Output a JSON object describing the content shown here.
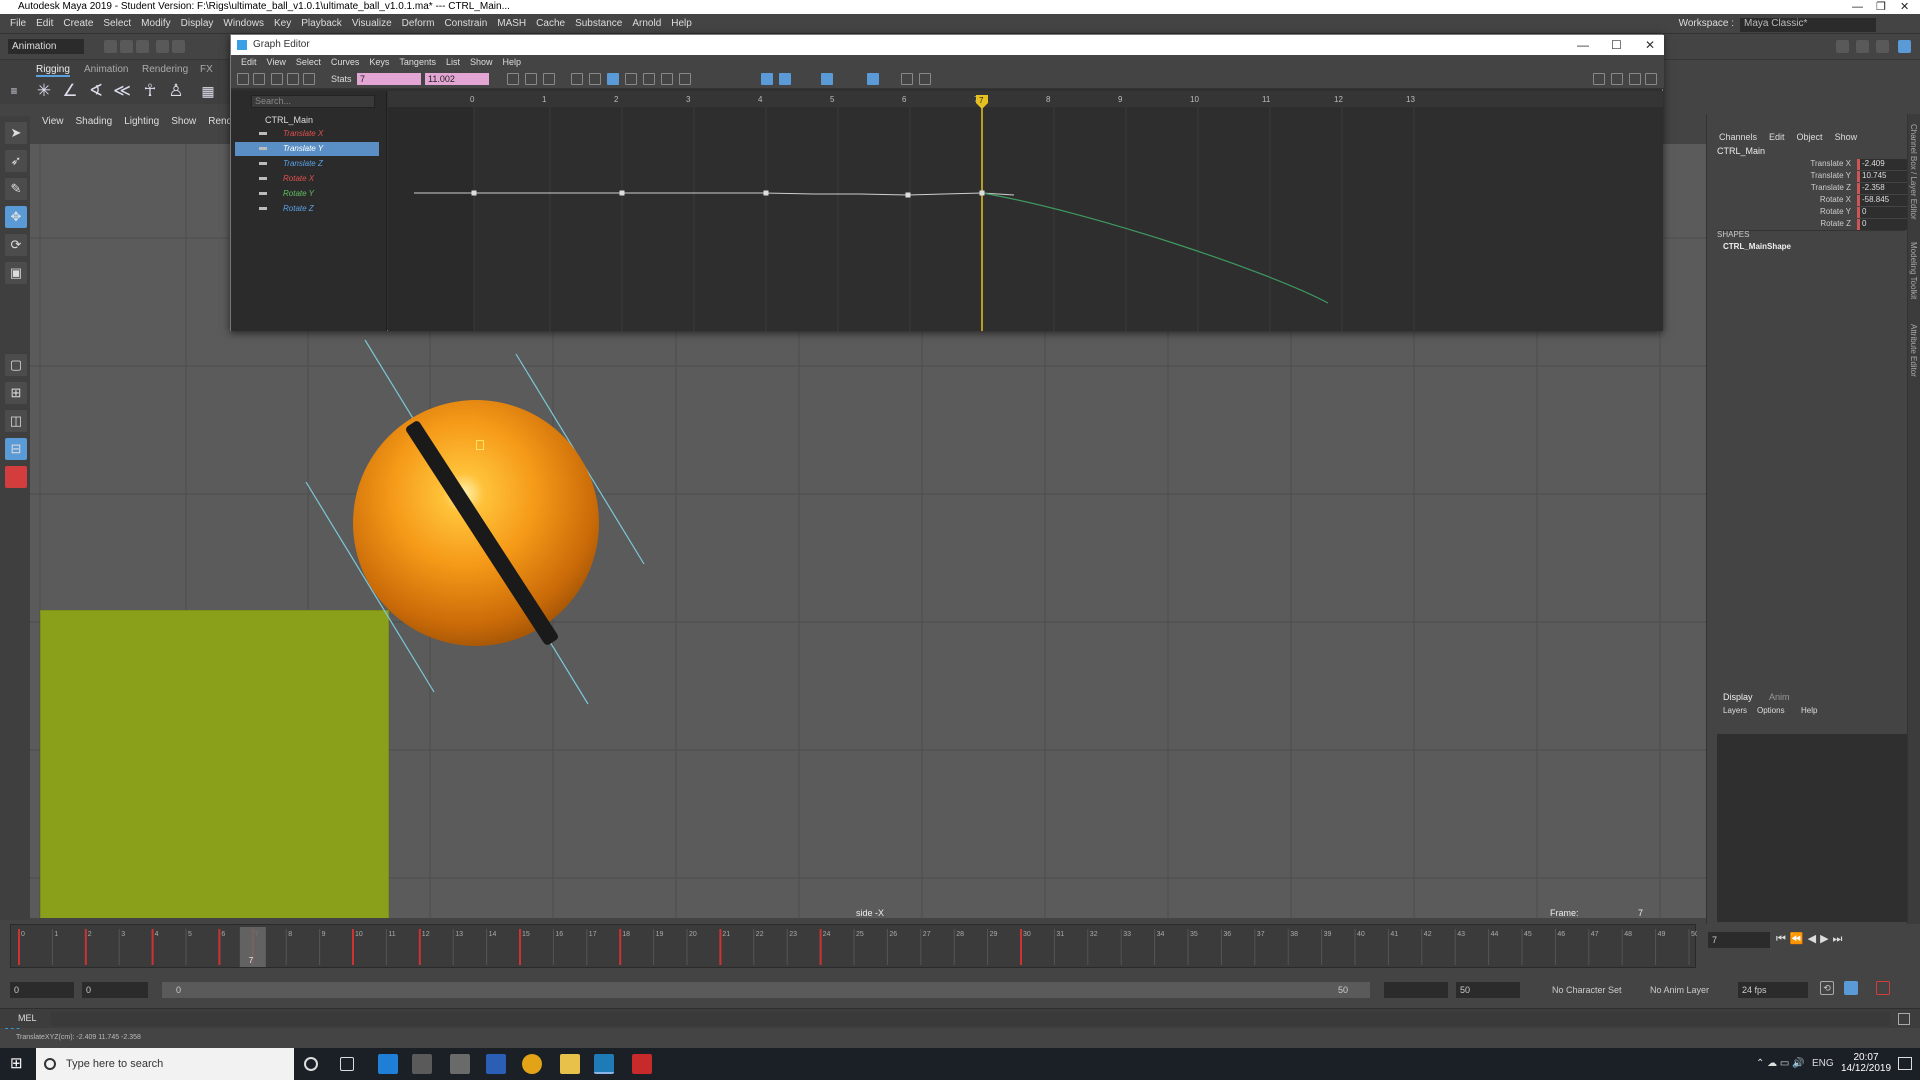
{
  "app": {
    "window_title": "Autodesk Maya 2019 - Student Version: F:\\Rigs\\ultimate_ball_v1.0.1\\ultimate_ball_v1.0.1.ma*  ---  CTRL_Main...",
    "menu": [
      "File",
      "Edit",
      "Create",
      "Select",
      "Modify",
      "Display",
      "Windows",
      "Key",
      "Playback",
      "Visualize",
      "Deform",
      "Constrain",
      "MASH",
      "Cache",
      "Substance",
      "Arnold",
      "Help"
    ],
    "workspace_label": "Workspace :",
    "workspace_value": "Maya Classic*",
    "mode_menu": "Animation"
  },
  "shelf": {
    "tabs": [
      "Rigging",
      "Animation",
      "Rendering",
      "FX"
    ],
    "active_tab": "Rigging"
  },
  "panel": {
    "menu": [
      "View",
      "Shading",
      "Lighting",
      "Show",
      "Renderer"
    ],
    "camera_label": "side -X",
    "frame_label": "Frame:",
    "frame_value": "7"
  },
  "graph_editor": {
    "title": "Graph Editor",
    "menu": [
      "Edit",
      "View",
      "Select",
      "Curves",
      "Keys",
      "Tangents",
      "List",
      "Show",
      "Help"
    ],
    "stats_label": "Stats",
    "stats_frame": "7",
    "stats_value": "11.002",
    "search_placeholder": "Search...",
    "outliner": {
      "root": "CTRL_Main",
      "channels": [
        {
          "label": "Translate X",
          "color": "#e05050"
        },
        {
          "label": "Translate Y",
          "color": "#ffffff",
          "selected": true
        },
        {
          "label": "Translate Z",
          "color": "#5aa0e6"
        },
        {
          "label": "Rotate X",
          "color": "#e05050"
        },
        {
          "label": "Rotate Y",
          "color": "#60c060"
        },
        {
          "label": "Rotate Z",
          "color": "#5aa0e6"
        }
      ]
    },
    "frame_ruler": [
      "0",
      "1",
      "2",
      "3",
      "4",
      "5",
      "6",
      "7",
      "8",
      "9",
      "10",
      "11",
      "12",
      "13"
    ],
    "current_frame": "7"
  },
  "channel_box": {
    "menu": [
      "Channels",
      "Edit",
      "Object",
      "Show"
    ],
    "object": "CTRL_Main",
    "channels": [
      {
        "name": "Translate X",
        "value": "-2.409"
      },
      {
        "name": "Translate Y",
        "value": "10.745"
      },
      {
        "name": "Translate Z",
        "value": "-2.358"
      },
      {
        "name": "Rotate X",
        "value": "-58.845"
      },
      {
        "name": "Rotate Y",
        "value": "0"
      },
      {
        "name": "Rotate Z",
        "value": "0"
      }
    ],
    "shapes_label": "SHAPES",
    "shape_name": "CTRL_MainShape",
    "layer_tabs": [
      "Display",
      "Anim"
    ],
    "layer_menu": [
      "Layers",
      "Options",
      "Help"
    ],
    "side_tabs": [
      "Channel Box / Layer Editor",
      "Modeling Toolkit",
      "Attribute Editor"
    ]
  },
  "timeline": {
    "ticks": [
      "0",
      "1",
      "2",
      "3",
      "4",
      "5",
      "6",
      "7",
      "8",
      "9",
      "10",
      "11",
      "12",
      "13",
      "14",
      "15",
      "16",
      "17",
      "18",
      "19",
      "20",
      "21",
      "22",
      "23",
      "24",
      "25",
      "26",
      "27",
      "28",
      "29",
      "30",
      "31",
      "32",
      "33",
      "34",
      "35",
      "36",
      "37",
      "38",
      "39",
      "40",
      "41",
      "42",
      "43",
      "44",
      "45",
      "46",
      "47",
      "48",
      "49",
      "50"
    ],
    "key_frames": [
      0,
      2,
      4,
      6,
      7,
      10,
      12,
      15,
      18,
      21,
      24,
      30
    ],
    "current_frame": "7",
    "current_frame_field": "7"
  },
  "range": {
    "start": "0",
    "inner_start": "0",
    "slider_start": "0",
    "slider_end": "50",
    "inner_end": "50",
    "character_set": "No Character Set",
    "anim_layer": "No Anim Layer",
    "fps": "24 fps"
  },
  "command_line": {
    "label": "MEL"
  },
  "help_line": {
    "text": "TranslateXYZ(cm):   -2.409       11.745       -2.358"
  },
  "taskbar": {
    "search_placeholder": "Type here to search",
    "lang": "ENG",
    "time": "20:07",
    "date": "14/12/2019"
  }
}
